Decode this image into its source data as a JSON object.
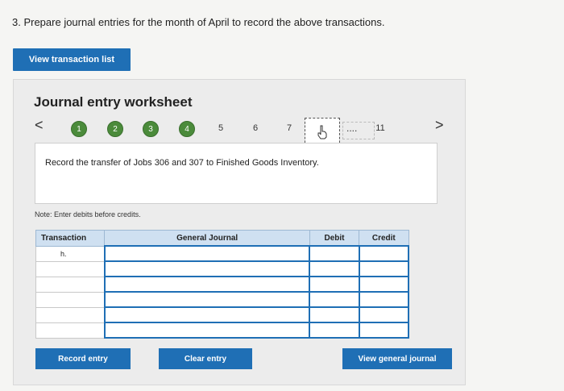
{
  "question": "3. Prepare journal entries for the month of April to record the above transactions.",
  "view_list_label": "View transaction list",
  "worksheet": {
    "title": "Journal entry worksheet",
    "prev_arrow": "<",
    "next_arrow": ">",
    "steps": [
      "1",
      "2",
      "3",
      "4",
      "5",
      "6",
      "7",
      "11"
    ],
    "ellipsis": "....",
    "instruction": "Record the transfer of Jobs 306 and 307 to Finished Goods Inventory.",
    "note": "Note: Enter debits before credits.",
    "table": {
      "headers": [
        "Transaction",
        "General Journal",
        "Debit",
        "Credit"
      ],
      "first_transaction": "h."
    },
    "buttons": {
      "record": "Record entry",
      "clear": "Clear entry",
      "view_journal": "View general journal"
    }
  }
}
